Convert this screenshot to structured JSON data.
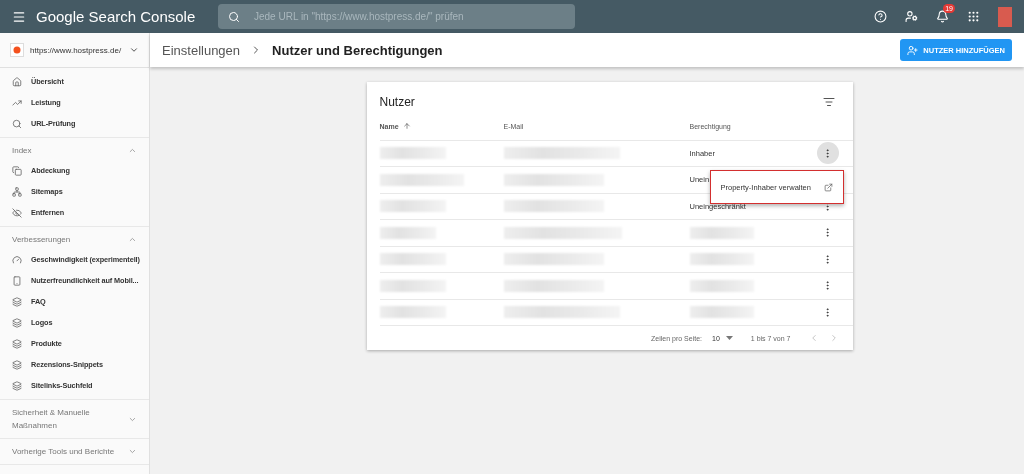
{
  "app_bar": {
    "product": "Google Search Console",
    "search_placeholder": "Jede URL in \"https://www.hostpress.de/\" prüfen",
    "notification_count": "19"
  },
  "property": "https://www.hostpress.de/",
  "breadcrumb": [
    "Einstellungen",
    "Nutzer und Berechtigungen"
  ],
  "add_button": "NUTZER HINZUFÜGEN",
  "sidebar": [
    {
      "items": [
        {
          "label": "Übersicht",
          "kind": "home"
        },
        {
          "label": "Leistung",
          "kind": "trend"
        },
        {
          "label": "URL-Prüfung",
          "kind": "search"
        }
      ]
    },
    {
      "title": "Index",
      "expanded": true,
      "items": [
        {
          "label": "Abdeckung",
          "kind": "pages"
        },
        {
          "label": "Sitemaps",
          "kind": "sitemap"
        },
        {
          "label": "Entfernen",
          "kind": "hidden"
        }
      ]
    },
    {
      "title": "Verbesserungen",
      "expanded": true,
      "items": [
        {
          "label": "Geschwindigkeit (experimentell)",
          "kind": "gauge"
        },
        {
          "label": "Nutzerfreundlichkeit auf Mobil...",
          "kind": "phone"
        },
        {
          "label": "FAQ",
          "kind": "enhancement"
        },
        {
          "label": "Logos",
          "kind": "enhancement"
        },
        {
          "label": "Produkte",
          "kind": "enhancement"
        },
        {
          "label": "Rezensions-Snippets",
          "kind": "enhancement"
        },
        {
          "label": "Sitelinks-Suchfeld",
          "kind": "enhancement"
        }
      ]
    },
    {
      "title": "Sicherheit & Manuelle Maßnahmen",
      "expanded": false
    },
    {
      "title": "Vorherige Tools und Berichte",
      "expanded": false
    }
  ],
  "card": {
    "title": "Nutzer",
    "columns": [
      {
        "label": "Name",
        "sorted": true
      },
      {
        "label": "E-Mail",
        "sorted": false
      },
      {
        "label": "Berechtigung",
        "sorted": false
      }
    ],
    "rows": [
      {
        "permission": "Inhaber",
        "menu_open": true
      },
      {
        "permission": "Unein",
        "menu_open": false
      },
      {
        "permission": "Uneingeschränkt",
        "menu_open": false
      },
      {
        "permission_redacted": true,
        "menu_open": false
      },
      {
        "permission_redacted": true,
        "menu_open": false
      },
      {
        "permission_redacted": true,
        "menu_open": false
      },
      {
        "permission_redacted": true,
        "menu_open": false
      }
    ],
    "rows_per_page_label": "Zeilen pro Seite:",
    "rows_per_page": "10",
    "range": "1 bis 7 von 7"
  },
  "popup_menu": {
    "item": "Property-Inhaber verwalten"
  }
}
